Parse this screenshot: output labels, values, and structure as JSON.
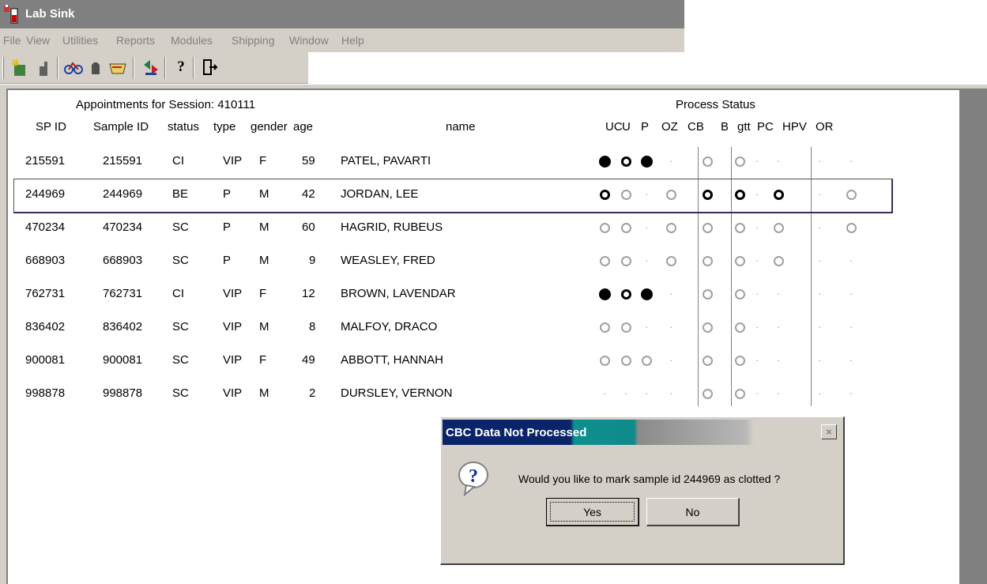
{
  "window": {
    "title": "Lab Sink"
  },
  "menu": [
    "File",
    "View",
    "Utilities",
    "Reports",
    "Modules",
    "Shipping",
    "Window",
    "Help"
  ],
  "toolbar": [
    "new-icon",
    "open-icon",
    "bike-icon",
    "stop-icon",
    "ticket-icon",
    "arrows-icon",
    "help-icon",
    "exit-icon"
  ],
  "session": {
    "heading": "Appointments for Session: 410111",
    "process_heading": "Process Status"
  },
  "columns": {
    "spid": "SP ID",
    "sample": "Sample ID",
    "status": "status",
    "type": "type",
    "gender": "gender",
    "age": "age",
    "name": "name",
    "process": [
      "UC",
      "U",
      "P",
      "OZ",
      "CB",
      "B",
      "gtt",
      "PC",
      "HPV",
      "OR"
    ]
  },
  "legend_colors": {
    "filled": "#000000",
    "bold": "#000000",
    "thin": "#a0a0a0",
    "empty": "#a0a0a0"
  },
  "rows": [
    {
      "spid": "215591",
      "sample": "215591",
      "status": "CI",
      "type": "VIP",
      "gender": "F",
      "age": "59",
      "name": "PATEL, PAVARTI",
      "process": [
        "filled",
        "bold",
        "filled",
        "dot",
        "thin",
        "thin",
        "dot",
        "dot",
        "dot",
        "dot"
      ]
    },
    {
      "spid": "244969",
      "sample": "244969",
      "status": "BE",
      "type": "P",
      "gender": "M",
      "age": "42",
      "name": "JORDAN, LEE",
      "process": [
        "bold",
        "thin",
        "dot",
        "thin",
        "bold",
        "bold",
        "dot",
        "bold",
        "dot",
        "thin"
      ]
    },
    {
      "spid": "470234",
      "sample": "470234",
      "status": "SC",
      "type": "P",
      "gender": "M",
      "age": "60",
      "name": "HAGRID, RUBEUS",
      "process": [
        "thin",
        "thin",
        "dot",
        "thin",
        "thin",
        "thin",
        "dot",
        "thin",
        "dot",
        "thin"
      ]
    },
    {
      "spid": "668903",
      "sample": "668903",
      "status": "SC",
      "type": "P",
      "gender": "M",
      "age": "9",
      "name": "WEASLEY, FRED",
      "process": [
        "thin",
        "thin",
        "dot",
        "thin",
        "thin",
        "thin",
        "dot",
        "thin",
        "dot",
        "dot"
      ]
    },
    {
      "spid": "762731",
      "sample": "762731",
      "status": "CI",
      "type": "VIP",
      "gender": "F",
      "age": "12",
      "name": "BROWN, LAVENDAR",
      "process": [
        "filled",
        "bold",
        "filled",
        "dot",
        "thin",
        "thin",
        "dot",
        "dot",
        "dot",
        "dot"
      ]
    },
    {
      "spid": "836402",
      "sample": "836402",
      "status": "SC",
      "type": "VIP",
      "gender": "M",
      "age": "8",
      "name": "MALFOY, DRACO",
      "process": [
        "thin",
        "thin",
        "dot",
        "dot",
        "thin",
        "thin",
        "dot",
        "dot",
        "dot",
        "dot"
      ]
    },
    {
      "spid": "900081",
      "sample": "900081",
      "status": "SC",
      "type": "VIP",
      "gender": "F",
      "age": "49",
      "name": "ABBOTT, HANNAH",
      "process": [
        "thin",
        "thin",
        "thin",
        "dot",
        "thin",
        "thin",
        "dot",
        "dot",
        "dot",
        "dot"
      ]
    },
    {
      "spid": "998878",
      "sample": "998878",
      "status": "SC",
      "type": "VIP",
      "gender": "M",
      "age": "2",
      "name": "DURSLEY, VERNON",
      "process": [
        "dot",
        "dot",
        "dot",
        "dot",
        "thin",
        "thin",
        "dot",
        "dot",
        "dot",
        "dot"
      ]
    }
  ],
  "selected_row": 1,
  "dialog": {
    "title": "CBC Data Not Processed",
    "close_label": "×",
    "icon": "question-icon",
    "message": "Would you like to mark sample id 244969 as clotted ?",
    "yes_label": "Yes",
    "no_label": "No"
  }
}
